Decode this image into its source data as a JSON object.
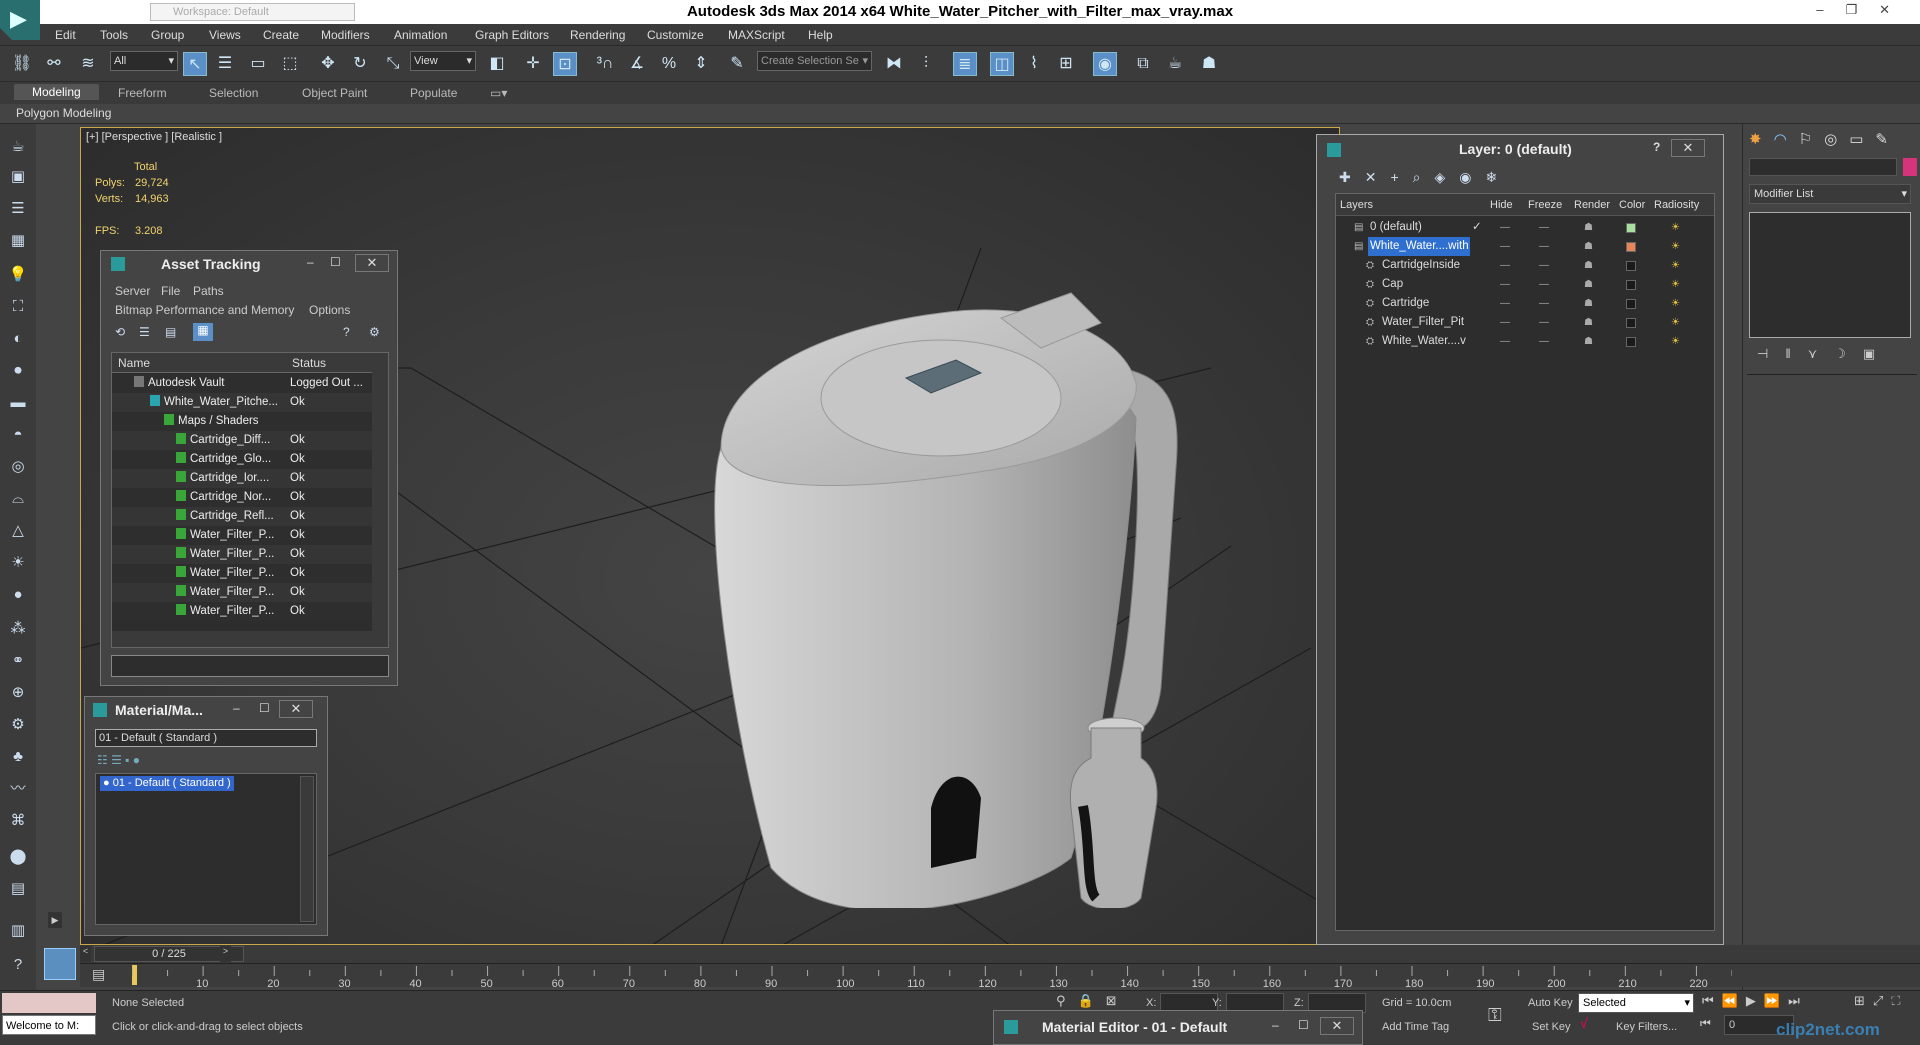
{
  "app": {
    "title": "Autodesk 3ds Max  2014 x64     White_Water_Pitcher_with_Filter_max_vray.max",
    "workspace": "Workspace: Default",
    "window_controls": [
      "–",
      "❐",
      "✕"
    ]
  },
  "menu": [
    "Edit",
    "Tools",
    "Group",
    "Views",
    "Create",
    "Modifiers",
    "Animation",
    "Graph Editors",
    "Rendering",
    "Customize",
    "MAXScript",
    "Help"
  ],
  "toolbar": {
    "filter_value": "All",
    "refcoord_value": "View",
    "selection_set_placeholder": "Create Selection Se"
  },
  "ribbon": {
    "tabs": [
      "Modeling",
      "Freeform",
      "Selection",
      "Object Paint",
      "Populate"
    ],
    "active_tab": "Modeling",
    "subpanel": "Polygon Modeling"
  },
  "viewport": {
    "label": "[+] [Perspective ] [Realistic ]",
    "stats": {
      "total_label": "Total",
      "polys_label": "Polys:",
      "polys_value": "29,724",
      "verts_label": "Verts:",
      "verts_value": "14,963",
      "fps_label": "FPS:",
      "fps_value": "3.208"
    }
  },
  "asset_tracking": {
    "title": "Asset Tracking",
    "menu": [
      "Server",
      "File",
      "Paths",
      "Bitmap Performance and Memory",
      "Options"
    ],
    "columns": [
      "Name",
      "Status"
    ],
    "rows": [
      {
        "name": "Autodesk Vault",
        "status": "Logged Out ..."
      },
      {
        "name": "White_Water_Pitche...",
        "status": "Ok"
      },
      {
        "name": "Maps / Shaders",
        "status": ""
      },
      {
        "name": "Cartridge_Diff...",
        "status": "Ok"
      },
      {
        "name": "Cartridge_Glo...",
        "status": "Ok"
      },
      {
        "name": "Cartridge_Ior....",
        "status": "Ok"
      },
      {
        "name": "Cartridge_Nor...",
        "status": "Ok"
      },
      {
        "name": "Cartridge_Refl...",
        "status": "Ok"
      },
      {
        "name": "Water_Filter_P...",
        "status": "Ok"
      },
      {
        "name": "Water_Filter_P...",
        "status": "Ok"
      },
      {
        "name": "Water_Filter_P...",
        "status": "Ok"
      },
      {
        "name": "Water_Filter_P...",
        "status": "Ok"
      },
      {
        "name": "Water_Filter_P...",
        "status": "Ok"
      }
    ]
  },
  "material_map": {
    "title": "Material/Ma...",
    "field_value": "01 - Default  ( Standard )",
    "list_item": "01 - Default  ( Standard )"
  },
  "layer_dialog": {
    "title": "Layer: 0 (default)",
    "help": "?",
    "columns": [
      "Layers",
      "Hide",
      "Freeze",
      "Render",
      "Color",
      "Radiosity"
    ],
    "rows": [
      {
        "name": "0 (default)",
        "color": "#a8e0a0",
        "selected": false,
        "indent": 1
      },
      {
        "name": "White_Water....with",
        "color": "#e8845a",
        "selected": true,
        "indent": 1
      },
      {
        "name": "CartridgeInside",
        "color": "#1a1a1a",
        "selected": false,
        "indent": 2
      },
      {
        "name": "Cap",
        "color": "#1a1a1a",
        "selected": false,
        "indent": 2
      },
      {
        "name": "Cartridge",
        "color": "#1a1a1a",
        "selected": false,
        "indent": 2
      },
      {
        "name": "Water_Filter_Pit",
        "color": "#1a1a1a",
        "selected": false,
        "indent": 2
      },
      {
        "name": "White_Water....v",
        "color": "#1a1a1a",
        "selected": false,
        "indent": 2
      }
    ]
  },
  "command_panel": {
    "modifier_list": "Modifier List",
    "color_swatch": "#d6337a"
  },
  "timeline": {
    "frame_display": "0 / 225",
    "ticks": [
      "10",
      "20",
      "30",
      "40",
      "50",
      "60",
      "70",
      "80",
      "90",
      "100",
      "110",
      "120",
      "130",
      "140",
      "150",
      "160",
      "170",
      "180",
      "190",
      "200",
      "210",
      "220"
    ]
  },
  "status": {
    "maxscript_listener": "Welcome to M:",
    "selection": "None Selected",
    "prompt": "Click or click-and-drag to select objects",
    "x_label": "X:",
    "y_label": "Y:",
    "z_label": "Z:",
    "grid": "Grid = 10.0cm",
    "add_time_tag": "Add Time Tag",
    "auto_key": "Auto Key",
    "set_key": "Set Key",
    "selected_value": "Selected",
    "key_filters": "Key Filters...",
    "frame_value": "0"
  },
  "material_editor": {
    "title": "Material Editor - 01 - Default"
  },
  "watermark": "clip2net.com"
}
